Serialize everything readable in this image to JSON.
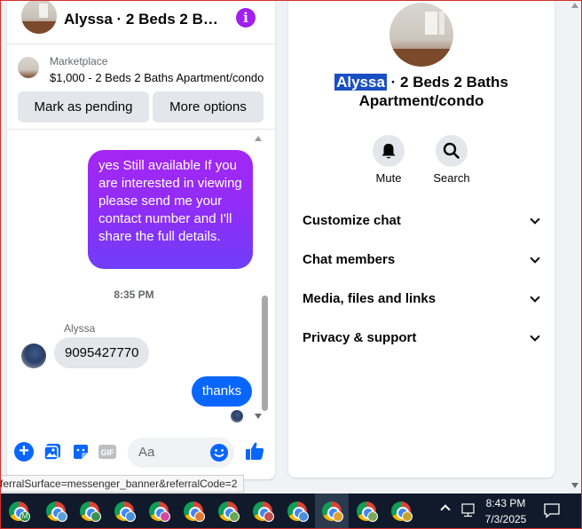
{
  "chat": {
    "title": "Alyssa · 2 Beds 2 Bat…",
    "marketplace": {
      "label": "Marketplace",
      "listing": "$1,000 - 2 Beds 2 Baths Apartment/condo",
      "pending_button": "Mark as pending",
      "more_button": "More options"
    },
    "messages": [
      {
        "from": "me",
        "text": "yes Still available If you are interested in viewing please send me your contact number and I'll share the full details."
      },
      {
        "type": "timestamp",
        "text": "8:35 PM"
      },
      {
        "from": "Alyssa",
        "sender_name": "Alyssa",
        "text": "9095427770"
      },
      {
        "from": "me",
        "text": "thanks"
      }
    ],
    "composer": {
      "placeholder": "Aa",
      "gif_label": "GIF"
    }
  },
  "info": {
    "name_highlighted": "Alyssa",
    "name_rest": " · 2 Beds 2 Baths Apartment/condo",
    "actions": [
      {
        "label": "Mute",
        "icon": "bell-icon"
      },
      {
        "label": "Search",
        "icon": "search-icon"
      }
    ],
    "sections": [
      {
        "label": "Customize chat"
      },
      {
        "label": "Chat members"
      },
      {
        "label": "Media, files and links"
      },
      {
        "label": "Privacy & support"
      }
    ]
  },
  "status_url": "ferralSurface=messenger_banner&referralCode=2",
  "taskbar": {
    "apps": [
      {
        "icon": "chrome-icon",
        "badge_color": "#1e8e3e",
        "badge_text": "M"
      },
      {
        "icon": "chrome-icon",
        "badge_color": "#5aa0d8",
        "badge_text": ""
      },
      {
        "icon": "chrome-icon",
        "badge_color": "#3b8f4a",
        "badge_text": ""
      },
      {
        "icon": "chrome-icon",
        "badge_color": "#4a90d9",
        "badge_text": ""
      },
      {
        "icon": "chrome-icon",
        "badge_color": "#d04aa0",
        "badge_text": ""
      },
      {
        "icon": "chrome-icon",
        "badge_color": "#e07a2e",
        "badge_text": ""
      },
      {
        "icon": "chrome-icon",
        "badge_color": "#6aa84f",
        "badge_text": ""
      },
      {
        "icon": "chrome-icon",
        "badge_color": "#c0504d",
        "badge_text": ""
      },
      {
        "icon": "chrome-icon",
        "badge_color": "#4a90d9",
        "badge_text": ""
      },
      {
        "icon": "chrome-icon",
        "badge_color": "#e0a030",
        "badge_text": "",
        "active": true
      },
      {
        "icon": "chrome-icon",
        "badge_color": "#7aa85a",
        "badge_text": ""
      },
      {
        "icon": "chrome-icon",
        "badge_color": "#c9a227",
        "badge_text": ""
      }
    ],
    "time": "8:43 PM",
    "date": "7/3/2025"
  },
  "colors": {
    "accent_blue": "#0866ff",
    "accent_purple": "#a020f0",
    "highlight": "#1a4fc4"
  }
}
